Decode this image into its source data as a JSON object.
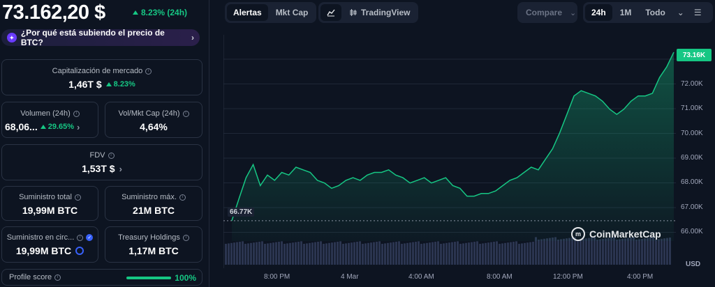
{
  "coin": {
    "price": "73.162,20 $",
    "change": "8.23% (24h)",
    "why_label": "¿Por qué está subiendo el precio de BTC?"
  },
  "stats": {
    "market_cap": {
      "label": "Capitalización de mercado",
      "value": "1,46T $",
      "change": "8.23%"
    },
    "volume": {
      "label": "Volumen (24h)",
      "value": "68,06...",
      "change": "29.65%"
    },
    "vol_mkt": {
      "label": "Vol/Mkt Cap (24h)",
      "value": "4,64%"
    },
    "fdv": {
      "label": "FDV",
      "value": "1,53T $"
    },
    "total_supply": {
      "label": "Suministro total",
      "value": "19,99M BTC"
    },
    "max_supply": {
      "label": "Suministro máx.",
      "value": "21M BTC"
    },
    "circ_supply": {
      "label": "Suministro en circ...",
      "value": "19,99M BTC"
    },
    "treasury": {
      "label": "Treasury Holdings",
      "value": "1,17M BTC"
    },
    "profile": {
      "label": "Profile score",
      "value": "100%",
      "level": 1.0
    }
  },
  "toolbar": {
    "tab_alerts": "Alertas",
    "tab_mktcap": "Mkt Cap",
    "tradingview": "TradingView",
    "compare": "Compare",
    "range_24h": "24h",
    "range_1m": "1M",
    "range_all": "Todo"
  },
  "chart_data": {
    "type": "area",
    "currency": "USD",
    "current_label": "73.16K",
    "low_label": "66.77K",
    "y_ticks": [
      "72.00K",
      "71.00K",
      "70.00K",
      "69.00K",
      "68.00K",
      "67.00K",
      "66.00K"
    ],
    "x_ticks": [
      "8:00 PM",
      "4 Mar",
      "4:00 AM",
      "8:00 AM",
      "12:00 PM",
      "4:00 PM"
    ],
    "ylim": [
      66000,
      73500
    ],
    "x": [
      0,
      1,
      2,
      3,
      4,
      5,
      6,
      7,
      8,
      9,
      10,
      11,
      12,
      13,
      14,
      15,
      16,
      17,
      18,
      19,
      20,
      21,
      22,
      23,
      24,
      25,
      26,
      27,
      28,
      29,
      30,
      31,
      32,
      33,
      34,
      35,
      36,
      37,
      38,
      39,
      40,
      41,
      42,
      43,
      44,
      45,
      46,
      47,
      48,
      49,
      50,
      51,
      52,
      53,
      54,
      55,
      56,
      57,
      58,
      59,
      60,
      61,
      62
    ],
    "values": [
      66770,
      67600,
      68400,
      68900,
      68100,
      68500,
      68300,
      68600,
      68500,
      68800,
      68700,
      68600,
      68300,
      68200,
      68000,
      68100,
      68300,
      68400,
      68300,
      68500,
      68600,
      68600,
      68700,
      68500,
      68400,
      68200,
      68300,
      68400,
      68200,
      68300,
      68400,
      68100,
      68000,
      67700,
      67700,
      67800,
      67800,
      67900,
      68100,
      68300,
      68400,
      68600,
      68800,
      68700,
      69100,
      69500,
      70100,
      70800,
      71500,
      71700,
      71600,
      71500,
      71300,
      71000,
      70800,
      71000,
      71300,
      71500,
      71500,
      71600,
      72200,
      72600,
      73160
    ],
    "grid": true,
    "legend": "none",
    "line_color": "#16c784"
  }
}
